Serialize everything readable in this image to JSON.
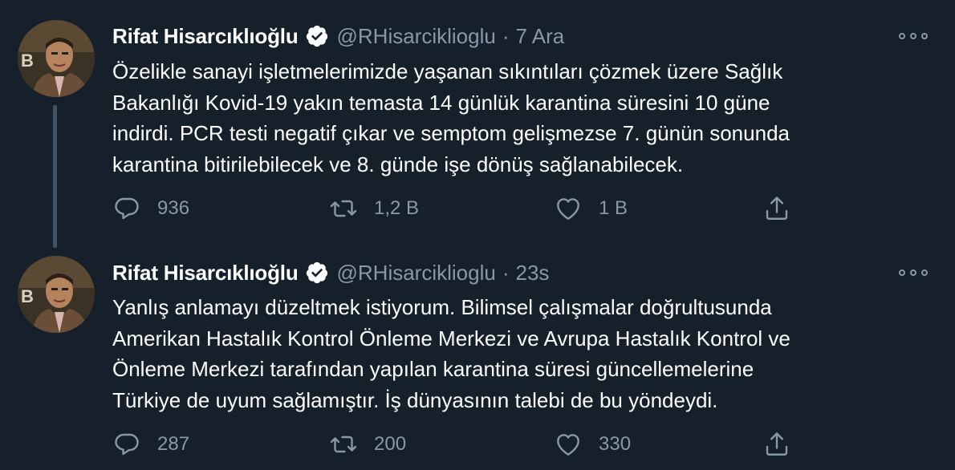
{
  "tweets": [
    {
      "author_name": "Rifat Hisarcıklıoğlu",
      "handle": "@RHisarciklioglu",
      "separator": "·",
      "time": "7 Ara",
      "text_lines": [
        "Özelikle sanayi işletmelerimizde yaşanan sıkıntıları çözmek üzere Sağlık",
        "Bakanlığı Kovid-19 yakın temasta 14 günlük karantina süresini 10 güne",
        "indirdi. PCR testi negatif çıkar ve semptom gelişmezse 7. günün sonunda",
        "karantina bitirilebilecek ve 8. günde işe dönüş sağlanabilecek."
      ],
      "replies": "936",
      "retweets": "1,2 B",
      "likes": "1 B"
    },
    {
      "author_name": "Rifat Hisarcıklıoğlu",
      "handle": "@RHisarciklioglu",
      "separator": "·",
      "time": "23s",
      "text_lines": [
        "Yanlış anlamayı düzeltmek istiyorum. Bilimsel çalışmalar doğrultusunda",
        "Amerikan Hastalık Kontrol Önleme Merkezi ve Avrupa Hastalık Kontrol ve",
        "Önleme Merkezi tarafından yapılan karantina süresi güncellemelerine",
        "Türkiye de uyum sağlamıştır. İş dünyasının talebi de bu yöndeydi."
      ],
      "replies": "287",
      "retweets": "200",
      "likes": "330"
    }
  ],
  "colors": {
    "background": "#15202b",
    "text_primary": "#ffffff",
    "text_secondary": "#8899a6",
    "thread_line": "#3d5466"
  },
  "icons": {
    "verified": "verified-badge-icon",
    "more": "more-options-icon",
    "reply": "reply-icon",
    "retweet": "retweet-icon",
    "like": "heart-icon",
    "share": "share-icon"
  }
}
